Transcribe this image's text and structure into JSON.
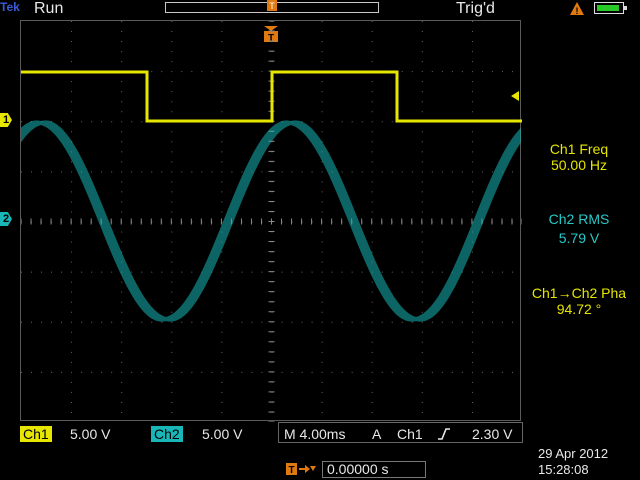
{
  "header": {
    "brand": "Tek",
    "state": "Run",
    "trigger_status": "Trig'd"
  },
  "colors": {
    "ch1": "#e6e600",
    "ch2": "#18b6b6",
    "battery": "#28c828"
  },
  "icons": [
    "warning-icon",
    "battery-icon",
    "trigger-position-icon",
    "trigger-slope-rising-icon"
  ],
  "channels": {
    "ch1": {
      "marker": "1",
      "tag": "Ch1",
      "scale": "5.00 V"
    },
    "ch2": {
      "marker": "2",
      "tag": "Ch2",
      "scale": "5.00 V"
    }
  },
  "measurements": [
    {
      "label": "Ch1 Freq",
      "value": "50.00 Hz"
    },
    {
      "label": "Ch2 RMS",
      "value": "5.79 V"
    },
    {
      "label": "Ch1→Ch2 Pha",
      "value": "94.72 °"
    }
  ],
  "horizontal": {
    "timebase": "M 4.00ms",
    "position": "0.00000 s"
  },
  "trigger": {
    "mode_letter": "A",
    "source": "Ch1",
    "level": "2.30 V"
  },
  "datetime": {
    "date": "29 Apr  2012",
    "time": "15:28:08"
  }
}
